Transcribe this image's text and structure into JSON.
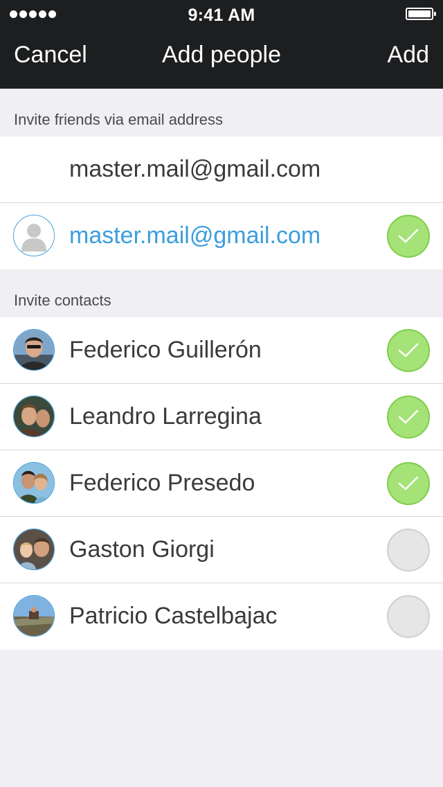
{
  "status_bar": {
    "time": "9:41 AM",
    "signal_dots": 5
  },
  "nav": {
    "cancel_label": "Cancel",
    "title": "Add people",
    "add_label": "Add"
  },
  "email_section": {
    "header": "Invite friends via email address",
    "input_value": "master.mail@gmail.com",
    "result": {
      "email": "master.mail@gmail.com",
      "selected": true,
      "avatar": "default-person-icon"
    }
  },
  "contacts_section": {
    "header": "Invite contacts",
    "contacts": [
      {
        "name": "Federico Guillerón",
        "selected": true
      },
      {
        "name": "Leandro Larregina",
        "selected": true
      },
      {
        "name": "Federico Presedo",
        "selected": true
      },
      {
        "name": "Gaston Giorgi",
        "selected": false
      },
      {
        "name": "Patricio Castelbajac",
        "selected": false
      }
    ]
  },
  "colors": {
    "topbar": "#1c1e20",
    "accent_blue": "#3b9ddd",
    "check_green": "#a5e278",
    "check_off": "#e6e6e6",
    "background": "#efeff4"
  }
}
